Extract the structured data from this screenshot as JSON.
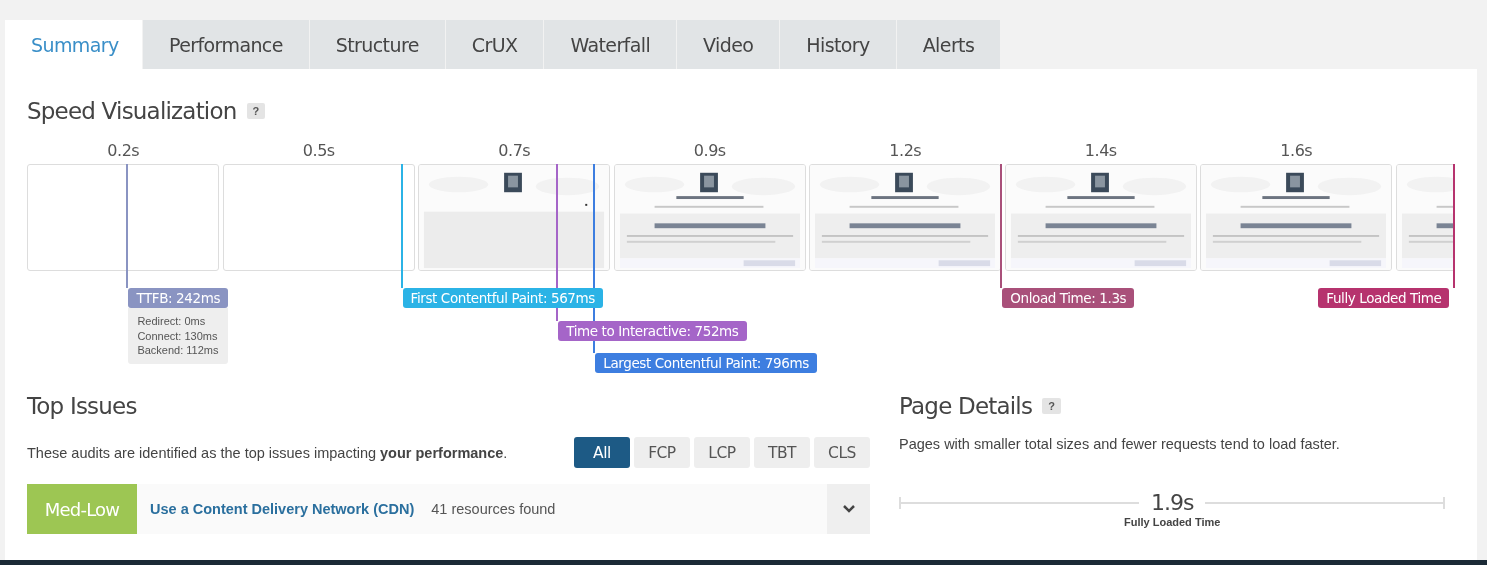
{
  "tabs": [
    {
      "label": "Summary",
      "selected": true
    },
    {
      "label": "Performance",
      "selected": false
    },
    {
      "label": "Structure",
      "selected": false
    },
    {
      "label": "CrUX",
      "selected": false
    },
    {
      "label": "Waterfall",
      "selected": false
    },
    {
      "label": "Video",
      "selected": false
    },
    {
      "label": "History",
      "selected": false
    },
    {
      "label": "Alerts",
      "selected": false
    }
  ],
  "speed_visualization": {
    "title": "Speed Visualization",
    "help": "?",
    "frames": [
      {
        "label": "0.2s",
        "kind": "blank"
      },
      {
        "label": "0.5s",
        "kind": "blank"
      },
      {
        "label": "0.7s",
        "kind": "partial"
      },
      {
        "label": "0.9s",
        "kind": "picture"
      },
      {
        "label": "1.2s",
        "kind": "picture"
      },
      {
        "label": "1.4s",
        "kind": "picture"
      },
      {
        "label": "1.6s",
        "kind": "picture"
      },
      {
        "kind": "picture"
      }
    ],
    "markers": [
      {
        "label": "TTFB: 242ms",
        "level": 0.071,
        "color": "#8a94c2",
        "details": [
          "Redirect: 0ms",
          "Connect: 130ms",
          "Backend: 112ms"
        ]
      },
      {
        "label": "First Contentful Paint: 567ms",
        "level": 0.263,
        "color": "#2bb3e6"
      },
      {
        "label": "Time to Interactive: 752ms",
        "level": 0.372,
        "color": "#a565c8"
      },
      {
        "label": "Largest Contentful Paint: 796ms",
        "level": 0.398,
        "color": "#3d7ee0"
      },
      {
        "label": "Onload Time: 1.3s",
        "level": 0.683,
        "color": "#a9507a"
      },
      {
        "label": "Fully Loaded Time",
        "level": 1,
        "color": "#b6336e"
      }
    ]
  },
  "top_issues": {
    "title": "Top Issues",
    "description": "These audits are identified as the top issues impacting **your performance**.",
    "filters": [
      {
        "label": "All",
        "selected": true
      },
      {
        "label": "FCP",
        "selected": false
      },
      {
        "label": "LCP",
        "selected": false
      },
      {
        "label": "TBT",
        "selected": false
      },
      {
        "label": "CLS",
        "selected": false
      }
    ],
    "issues": [
      {
        "impact": "Med-Low",
        "title": "Use a Content Delivery Network (CDN)",
        "summary": "41 resources found",
        "expanded": false
      }
    ]
  },
  "page_details": {
    "title": "Page Details",
    "help": "?",
    "description": "Pages with smaller total sizes and fewer requests tend to load faster.",
    "value": "1.9s",
    "caption": "Fully Loaded Time"
  }
}
